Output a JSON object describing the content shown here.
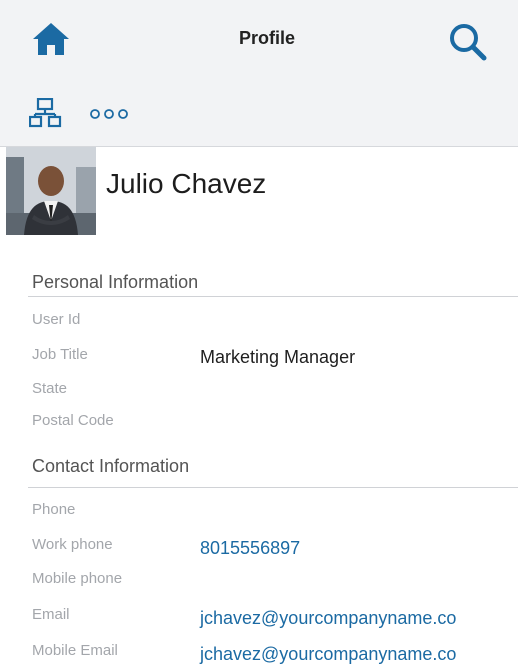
{
  "header": {
    "title": "Profile",
    "home_icon": "home-icon",
    "search_icon": "search-icon",
    "accent_color": "#1b6aa3"
  },
  "toolbar": {
    "org_icon": "org-chart-icon",
    "more_icon": "more-options-icon"
  },
  "profile": {
    "name": "Julio Chavez",
    "avatar_icon": "avatar-photo"
  },
  "personal": {
    "title": "Personal Information",
    "fields": [
      {
        "label": "User Id",
        "value": ""
      },
      {
        "label": "Job Title",
        "value": "Marketing Manager"
      },
      {
        "label": "State",
        "value": ""
      },
      {
        "label": "Postal Code",
        "value": ""
      }
    ]
  },
  "contact": {
    "title": "Contact Information",
    "fields": [
      {
        "label": "Phone",
        "value": ""
      },
      {
        "label": "Work phone",
        "value": "8015556897"
      },
      {
        "label": "Mobile phone",
        "value": ""
      },
      {
        "label": "Email",
        "value": "jchavez@yourcompanyname.co"
      },
      {
        "label": "Mobile Email",
        "value": "jchavez@yourcompanyname.co"
      }
    ]
  }
}
